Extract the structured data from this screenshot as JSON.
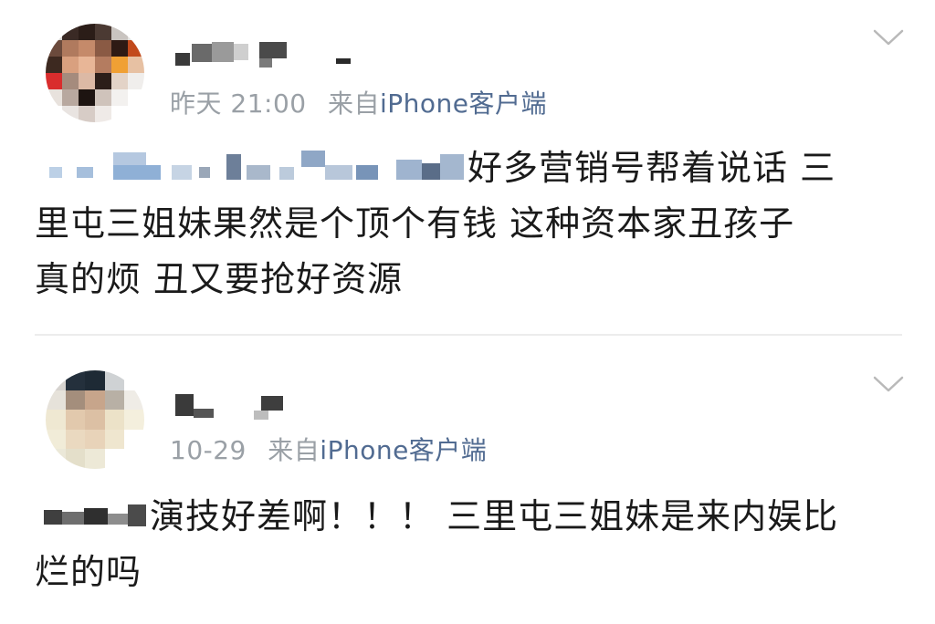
{
  "posts": [
    {
      "time": "昨天 21:00",
      "source_prefix": "来自",
      "source_app": "iPhone客户端",
      "text_line1": "好多营销号帮着说话 三",
      "text_line2": "里屯三姐妹果然是个顶个有钱 这种资本家丑孩子",
      "text_line3": "真的烦 丑又要抢好资源",
      "chevron_icon": "chevron-down-icon"
    },
    {
      "time": "10-29",
      "source_prefix": "来自",
      "source_app": "iPhone客户端",
      "text_line1": "演技好差啊！！！ 三里屯三姐妹是来内娱比",
      "text_line2": "烂的吗",
      "chevron_icon": "chevron-down-icon"
    }
  ],
  "colors": {
    "text": "#1a1a1a",
    "meta": "#9aa0a6",
    "source_link": "#516b91",
    "divider": "#ececec"
  }
}
